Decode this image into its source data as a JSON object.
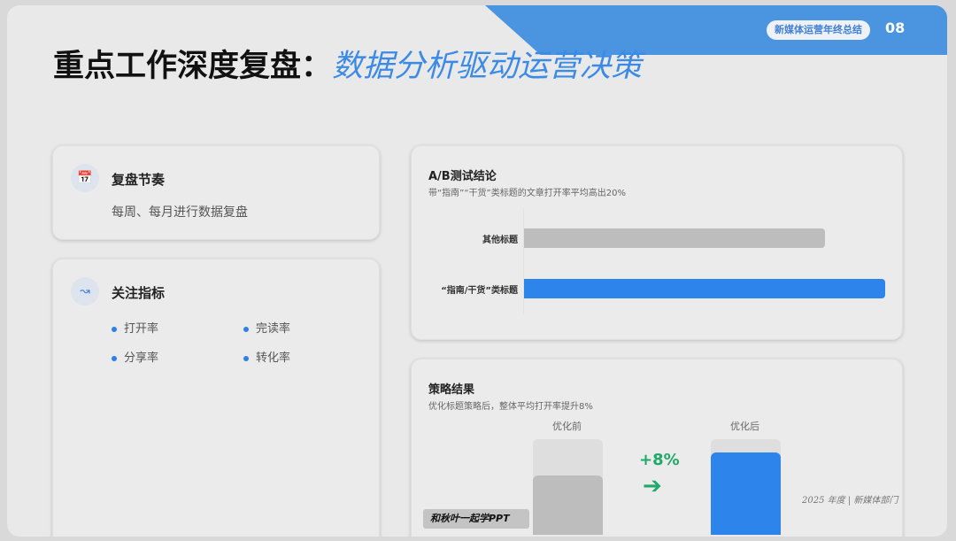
{
  "header": {
    "badge": "新媒体运营年终总结",
    "page_number": "08"
  },
  "title": {
    "main": "重点工作深度复盘：",
    "highlight": "数据分析驱动运营决策"
  },
  "cards": [
    {
      "icon": "calendar-check-icon",
      "title": "复盘节奏",
      "desc": "每周、每月进行数据复盘"
    },
    {
      "icon": "line-chart-icon",
      "title": "关注指标",
      "metrics": [
        "打开率",
        "完读率",
        "分享率",
        "转化率"
      ]
    }
  ],
  "ab_test": {
    "title": "A/B测试结论",
    "subtitle": "带“指南”“干货”类标题的文章打开率平均高出20%",
    "bars": [
      {
        "label": "其他标题",
        "value": 100,
        "color": "#bdbdbd"
      },
      {
        "label": "“指南/干货”类标题",
        "value": 120,
        "color": "#2d84ea"
      }
    ],
    "max": 120
  },
  "strategy": {
    "title": "策略结果",
    "subtitle": "优化标题策略后，整体平均打开率提升8%",
    "before": {
      "label": "优化前",
      "fill_pct": 62,
      "color": "#bdbdbd"
    },
    "after": {
      "label": "优化后",
      "fill_pct": 86,
      "color": "#2d84ea"
    },
    "delta": "+8%",
    "delta_color": "#21a86b"
  },
  "footer": {
    "note": "2025 年度 | 新媒体部门",
    "watermark": "和秋叶一起学PPT"
  }
}
